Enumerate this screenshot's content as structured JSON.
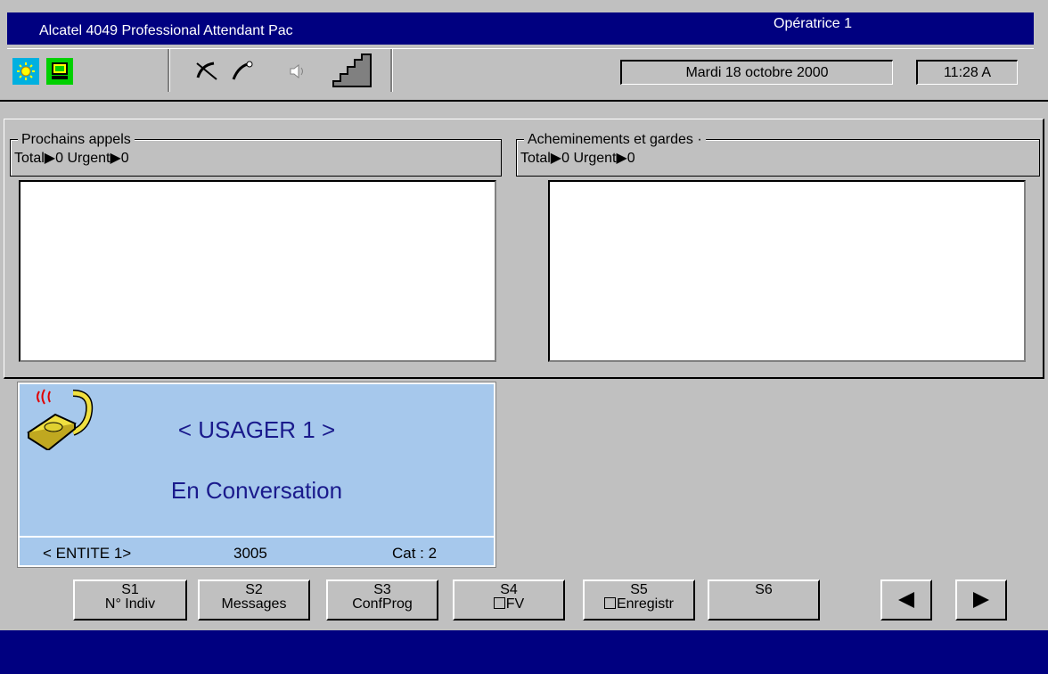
{
  "window": {
    "title": "Alcatel 4049 Professional Attendant Pac",
    "operator": "Opératrice 1"
  },
  "toolbar": {
    "icons": [
      "sun-icon",
      "monitor-icon",
      "mute-handset-icon",
      "handset-icon",
      "speaker-icon",
      "volume-stairs-icon"
    ],
    "date": "Mardi 18 octobre 2000",
    "time": "11:28 A"
  },
  "queues": {
    "next_calls": {
      "title": "Prochains appels",
      "counts": "Total▶0  Urgent▶0"
    },
    "routing": {
      "title": "Acheminements et gardes ·",
      "counts": "Total▶0  Urgent▶0"
    }
  },
  "call": {
    "user": "< USAGER 1 >",
    "status": "En Conversation",
    "entity": "< ENTITE 1>",
    "number": "3005",
    "category": "Cat : 2"
  },
  "softkeys": [
    {
      "key": "S1",
      "label": "N° Indiv"
    },
    {
      "key": "S2",
      "label": "Messages"
    },
    {
      "key": "S3",
      "label": "ConfProg"
    },
    {
      "key": "S4",
      "label": "FV"
    },
    {
      "key": "S5",
      "label": "Enregistr"
    },
    {
      "key": "S6",
      "label": ""
    }
  ],
  "colors": {
    "titlebar": "#000080",
    "call_panel": "#a6c8ec",
    "call_text": "#1a1a8c"
  }
}
